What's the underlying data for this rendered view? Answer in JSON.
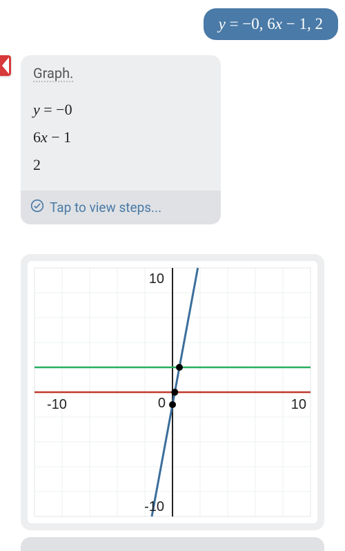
{
  "user_input": {
    "label": "y = −0, 6x − 1, 2"
  },
  "answer": {
    "heading": "Graph.",
    "lines": [
      "y = −0",
      "6x − 1",
      "2"
    ],
    "steps_label": "Tap to view steps..."
  },
  "chart_data": {
    "type": "line",
    "xlim": [
      -10,
      10
    ],
    "ylim": [
      -10,
      10
    ],
    "x_ticks": [
      -10,
      0,
      10
    ],
    "y_ticks": [
      -10,
      10
    ],
    "origin_label": "0",
    "grid": true,
    "series": [
      {
        "name": "y = -0",
        "color": "#c0392b",
        "type": "hline",
        "y": 0
      },
      {
        "name": "y = 6x - 1",
        "color": "#3b6e9b",
        "type": "line",
        "slope": 6,
        "intercept": -1
      },
      {
        "name": "y = 2",
        "color": "#27ae60",
        "type": "hline",
        "y": 2
      }
    ],
    "points": [
      {
        "x": 0.1667,
        "y": 0,
        "label": "intersection line & y=0"
      },
      {
        "x": 0.5,
        "y": 2,
        "label": "intersection line & y=2"
      },
      {
        "x": 0,
        "y": -1,
        "label": "y-intercept"
      }
    ]
  }
}
